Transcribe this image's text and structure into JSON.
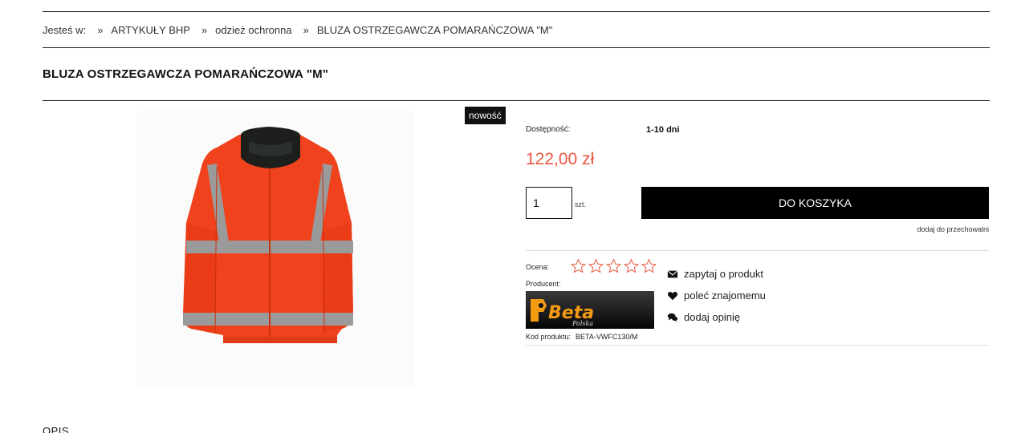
{
  "breadcrumb": {
    "prefix": "Jesteś w:",
    "separator": "»",
    "items": [
      {
        "label": "ARTYKUŁY BHP"
      },
      {
        "label": "odzież ochronna"
      },
      {
        "label": "BLUZA OSTRZEGAWCZA POMARAŃCZOWA \"M\""
      }
    ]
  },
  "product": {
    "title": "BLUZA OSTRZEGAWCZA POMARAŃCZOWA \"M\"",
    "badge": "nowość",
    "availability_label": "Dostępność:",
    "availability_value": "1-10 dni",
    "price": "122,00 zł",
    "quantity": "1",
    "quantity_unit": "szt.",
    "add_to_cart_label": "DO KOSZYKA",
    "storage_link": "dodaj do przechowalni",
    "rating_label": "Ocena:",
    "rating_value": 0,
    "rating_max": 5,
    "producer_label": "Producent:",
    "brand_name": "Beta",
    "brand_subtitle": "Polska",
    "code_label": "Kod produktu:",
    "code_value": "BETA-VWFC130/M"
  },
  "actions": [
    {
      "label": "zapytaj o produkt",
      "icon": "envelope-icon"
    },
    {
      "label": "poleć znajomemu",
      "icon": "heart-icon"
    },
    {
      "label": "dodaj opinię",
      "icon": "comments-icon"
    }
  ],
  "description_heading": "OPIS",
  "colors": {
    "price": "#e8573e",
    "star_outline": "#e8573e",
    "button_bg": "#000000",
    "jacket_orange": "#f0421c",
    "reflective_gray": "#9a9a9a"
  }
}
